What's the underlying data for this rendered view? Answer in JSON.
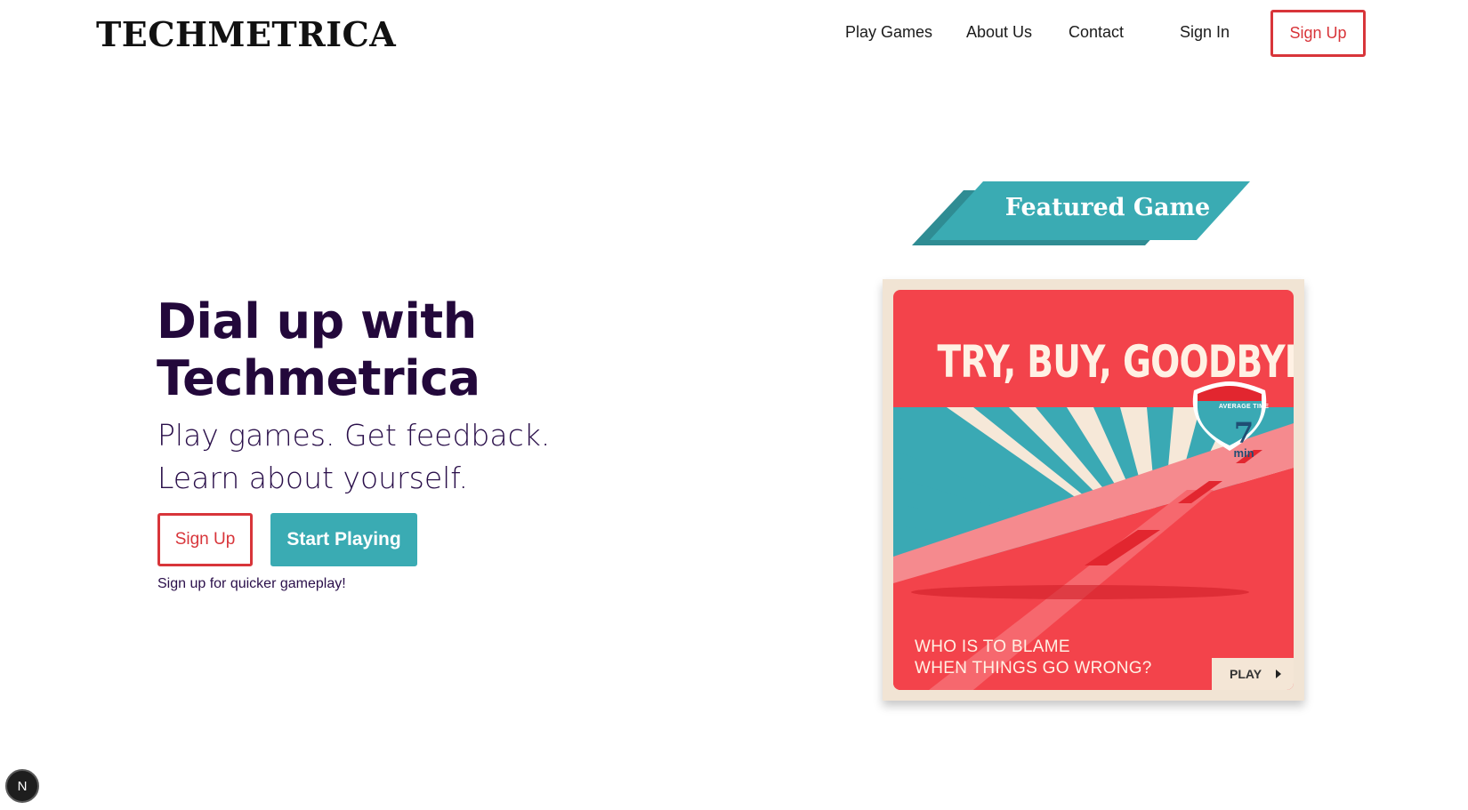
{
  "brand": {
    "logo": "TECHMETRICA"
  },
  "nav": {
    "links": [
      {
        "label": "Play Games"
      },
      {
        "label": "About Us"
      },
      {
        "label": "Contact"
      },
      {
        "label": "Sign In"
      }
    ],
    "signup_label": "Sign Up"
  },
  "hero": {
    "title_line1": "Dial up with",
    "title_line2": "Techmetrica",
    "subtitle_line1": "Play games. Get feedback.",
    "subtitle_line2": "Learn about yourself.",
    "signup_label": "Sign Up",
    "start_label": "Start Playing",
    "note": "Sign up for quicker gameplay!"
  },
  "featured": {
    "banner_label": "Featured Game",
    "game": {
      "title": "TRY, BUY, GOODBYE",
      "badge_caption": "AVERAGE TIME",
      "badge_value": "7",
      "badge_unit": "min",
      "tagline_line1": "WHO IS TO BLAME",
      "tagline_line2": "WHEN THINGS GO WRONG?",
      "play_label": "PLAY"
    }
  },
  "dev_badge": {
    "label": "N"
  },
  "colors": {
    "accent_red": "#d8353a",
    "accent_teal": "#3aabb3",
    "heading_purple": "#23083b",
    "card_red": "#f3434b",
    "card_cream": "#f1e4d4"
  }
}
